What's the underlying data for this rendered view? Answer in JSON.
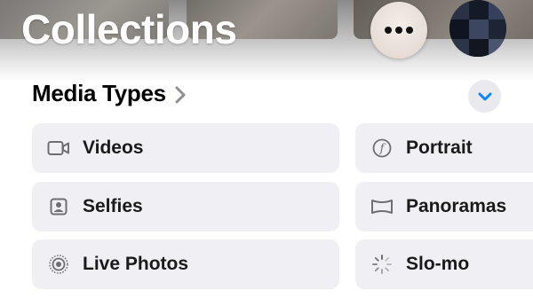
{
  "header": {
    "title": "Collections",
    "more_icon": "ellipsis-icon",
    "avatar_icon": "profile-avatar"
  },
  "section": {
    "title": "Media Types",
    "chevron_icon": "chevron-right-icon",
    "collapse_icon": "chevron-down-icon",
    "accent_color": "#0a84ff"
  },
  "media_types": [
    {
      "label": "Videos",
      "icon": "video-icon"
    },
    {
      "label": "Portrait",
      "icon": "portrait-f-icon"
    },
    {
      "label": "Selfies",
      "icon": "selfie-icon"
    },
    {
      "label": "Panoramas",
      "icon": "panorama-icon"
    },
    {
      "label": "Live Photos",
      "icon": "live-photo-icon"
    },
    {
      "label": "Slo-mo",
      "icon": "slo-mo-icon"
    }
  ]
}
